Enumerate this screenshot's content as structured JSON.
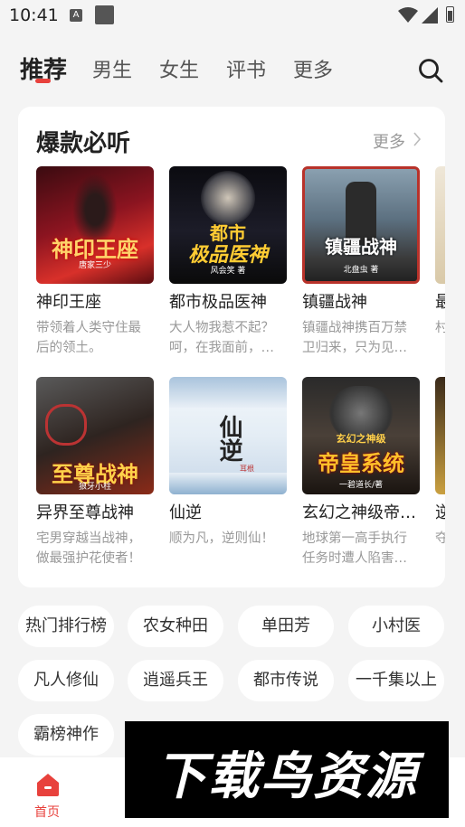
{
  "status": {
    "time": "10:41",
    "notif_letter": "A"
  },
  "tabs": [
    {
      "label": "推荐"
    },
    {
      "label": "男生"
    },
    {
      "label": "女生"
    },
    {
      "label": "评书"
    },
    {
      "label": "更多"
    }
  ],
  "section": {
    "title": "爆款必听",
    "more": "更多"
  },
  "books_row1": [
    {
      "title": "神印王座",
      "desc": "带领着人类守住最后的领土。",
      "cover_text": "神印王座",
      "cover_author": "唐家三少"
    },
    {
      "title": "都市极品医神",
      "desc": "大人物我惹不起？呵，在我面前，…",
      "cover_text": "极品医神",
      "cover_top": "都市",
      "cover_author": "风会笑 著"
    },
    {
      "title": "镇疆战神",
      "desc": "镇疆战神携百万禁卫归来，只为见…",
      "cover_text": "镇疆战神",
      "cover_author": "北盘虫 著"
    },
    {
      "title": "最",
      "desc": "村豪"
    }
  ],
  "books_row2": [
    {
      "title": "异界至尊战神",
      "desc": "宅男穿越当战神，做最强护花使者！",
      "cover_text": "至尊战神",
      "cover_author": "狼牙小柱"
    },
    {
      "title": "仙逆",
      "desc": "顺为凡，逆则仙！",
      "cover_text": "仙逆",
      "cover_author": "耳根"
    },
    {
      "title": "玄幻之神级帝…",
      "desc": "地球第一高手执行任务时遭人陷害…",
      "cover_text": "帝皇系统",
      "cover_top": "玄幻之神级",
      "cover_author": "一碧道长/著"
    },
    {
      "title": "逆",
      "desc": "夺乱"
    }
  ],
  "tags": [
    "热门排行榜",
    "农女种田",
    "单田芳",
    "小村医",
    "凡人修仙",
    "逍遥兵王",
    "都市传说",
    "一千集以上",
    "霸榜神作"
  ],
  "bottom_nav": {
    "home": "首页"
  },
  "watermark": "下载鸟资源",
  "colors": {
    "accent": "#e8413c",
    "background": "#f4f4f4"
  }
}
